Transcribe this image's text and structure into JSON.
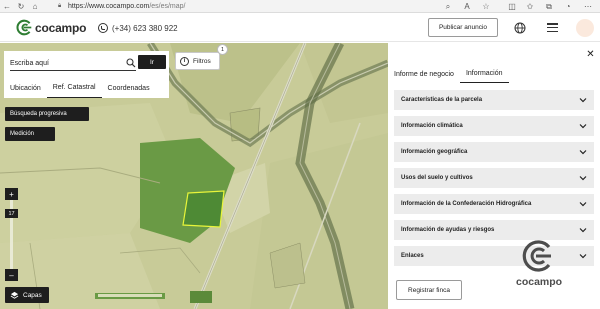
{
  "browser": {
    "url_host": "https://www.cocampo.com",
    "url_path": "/es/es/map/"
  },
  "header": {
    "logo_text": "cocampo",
    "phone": "(+34) 623 380 922",
    "publish_label": "Publicar anuncio"
  },
  "search": {
    "placeholder": "Escriba aquí",
    "go_label": "Ir",
    "tabs": [
      "Ubicación",
      "Ref. Catastral",
      "Coordenadas"
    ],
    "active_tab": "Ref. Catastral"
  },
  "map": {
    "filters_label": "Filtros",
    "filters_count": "1",
    "progressive_search_label": "Búsqueda progresiva",
    "measure_label": "Medición",
    "zoom_in": "+",
    "zoom_out": "–",
    "zoom_level": "17",
    "layers_label": "Capas"
  },
  "panel": {
    "tabs": [
      "Informe de negocio",
      "Información"
    ],
    "active_tab": "Información",
    "sections": [
      "Características de la parcela",
      "Información climática",
      "Información geográfica",
      "Usos del suelo y cultivos",
      "Información de la Confederación Hidrográfica",
      "Información de ayudas y riesgos",
      "Enlaces"
    ],
    "register_label": "Registrar finca",
    "watermark_text": "cocampo"
  },
  "colors": {
    "accent_dark": "#1e1e1e",
    "map_field": "#c9cc99",
    "parcel_green": "#5b8a3a",
    "parcel_outline": "#e8f53a"
  }
}
